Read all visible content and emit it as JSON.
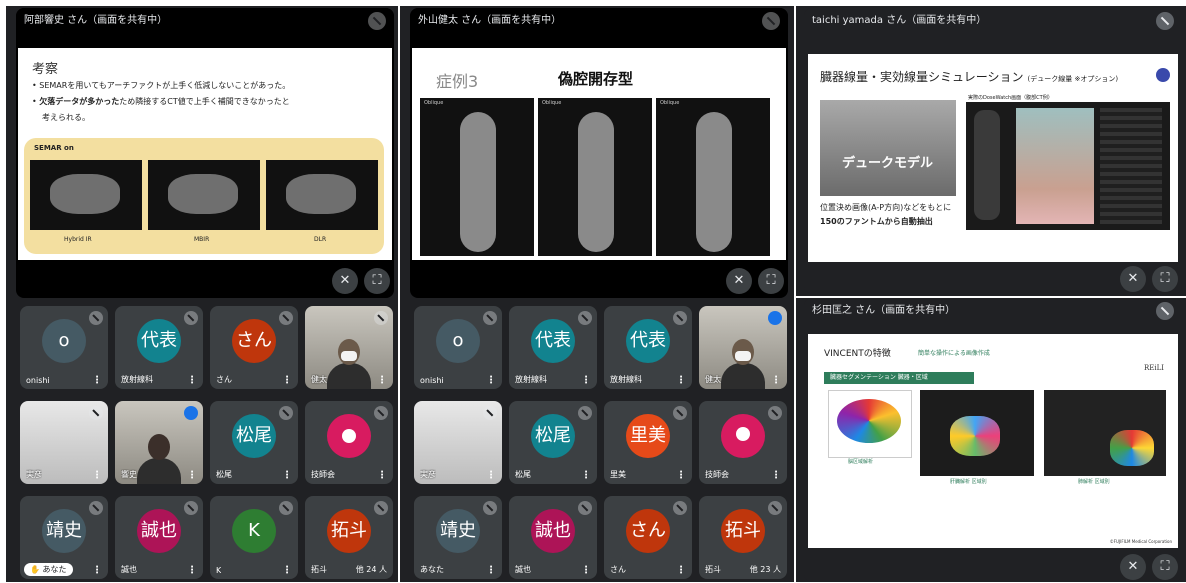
{
  "window1": {
    "presenter_title": "阿部響史 さん（画面を共有中）",
    "slide": {
      "heading": "考察",
      "bullet1": "SEMARを用いてもアーチファクトが上手く低減しないことがあった。",
      "bullet2_bold": "欠落データが多かった",
      "bullet2_rest": "ため隣接するCT値で上手く補間できなかったと",
      "bullet2_cont": "考えられる。",
      "box_label": "SEMAR on",
      "captions": [
        "Hybrid IR",
        "MBIR",
        "DLR"
      ]
    },
    "tiles": [
      {
        "type": "avatar",
        "initial": "o",
        "name": "onishi",
        "color": "#455a64"
      },
      {
        "type": "avatar",
        "initial": "代表",
        "name": "放射線科",
        "color": "#12838f"
      },
      {
        "type": "avatar",
        "initial": "さん",
        "name": "さん",
        "color": "#bf360c"
      },
      {
        "type": "camera",
        "name": "健太"
      },
      {
        "type": "camera",
        "name": "実彦"
      },
      {
        "type": "camera",
        "name": "響史",
        "mic": "blue"
      },
      {
        "type": "avatar",
        "initial": "松尾",
        "name": "松尾",
        "color": "#12838f"
      },
      {
        "type": "avatar",
        "initial": "●",
        "name": "技師会",
        "color": "#d81b60"
      },
      {
        "type": "avatar",
        "initial": "靖史",
        "name": "あなた",
        "color": "#455a64",
        "pill": "あなた"
      },
      {
        "type": "avatar",
        "initial": "誠也",
        "name": "誠也",
        "color": "#ad1457"
      },
      {
        "type": "avatar",
        "initial": "K",
        "name": "K",
        "color": "#2e7d32"
      },
      {
        "type": "avatar",
        "initial": "拓斗",
        "name": "拓斗",
        "color": "#bf360c",
        "more": "他 24 人"
      }
    ]
  },
  "window2": {
    "presenter_title": "外山健太 さん（画面を共有中）",
    "slide": {
      "case": "症例3",
      "title": "偽腔開存型",
      "labels": [
        "Oblique",
        "Oblique",
        "Oblique"
      ]
    },
    "tiles": [
      {
        "type": "avatar",
        "initial": "o",
        "name": "onishi",
        "color": "#455a64"
      },
      {
        "type": "avatar",
        "initial": "代表",
        "name": "放射線科",
        "color": "#12838f"
      },
      {
        "type": "avatar",
        "initial": "代表",
        "name": "放射線科",
        "color": "#12838f"
      },
      {
        "type": "camera",
        "name": "健太",
        "mic": "blue"
      },
      {
        "type": "camera",
        "name": "実彦"
      },
      {
        "type": "avatar",
        "initial": "松尾",
        "name": "松尾",
        "color": "#12838f"
      },
      {
        "type": "avatar",
        "initial": "里美",
        "name": "里美",
        "color": "#e64a19"
      },
      {
        "type": "avatar",
        "initial": "●",
        "name": "技師会",
        "color": "#d81b60"
      },
      {
        "type": "avatar",
        "initial": "靖史",
        "name": "あなた",
        "color": "#455a64"
      },
      {
        "type": "avatar",
        "initial": "誠也",
        "name": "誠也",
        "color": "#ad1457"
      },
      {
        "type": "avatar",
        "initial": "さん",
        "name": "さん",
        "color": "#bf360c"
      },
      {
        "type": "avatar",
        "initial": "拓斗",
        "name": "拓斗",
        "color": "#bf360c",
        "more": "他 23 人"
      }
    ]
  },
  "window3": {
    "presenter_title": "taichi yamada さん（画面を共有中）",
    "slide": {
      "title": "臓器線量・実効線量シミュレーション",
      "subtitle": "(デューク線量 ※オプション)",
      "screen_label": "実際のDoseWatch画面（腹部CT例）",
      "overlay": "デュークモデル",
      "text1": "位置決め画像(A-P方向)などをもとに",
      "text2": "150のファントムから自動抽出"
    }
  },
  "window4": {
    "presenter_title": "杉田匡之 さん（画面を共有中）",
    "slide": {
      "heading": "VINCENTの特徴",
      "subheading": "簡単な操作による画像作成",
      "logo": "REiLI",
      "green_bar": "臓器セグメンテーション 臓器・区域",
      "caption1": "脳区域解析",
      "caption2": "肝臓解析  区域別",
      "caption3": "肺解析  区域別",
      "footer": "©FUJIFILM Medical Corporation"
    }
  },
  "colors": {
    "meet_bg": "#202124",
    "tile_bg": "#3c4043",
    "accent_blue": "#1a73e8",
    "slide_yellow": "#f3dfa0",
    "green_bar": "#2e7d5b"
  }
}
